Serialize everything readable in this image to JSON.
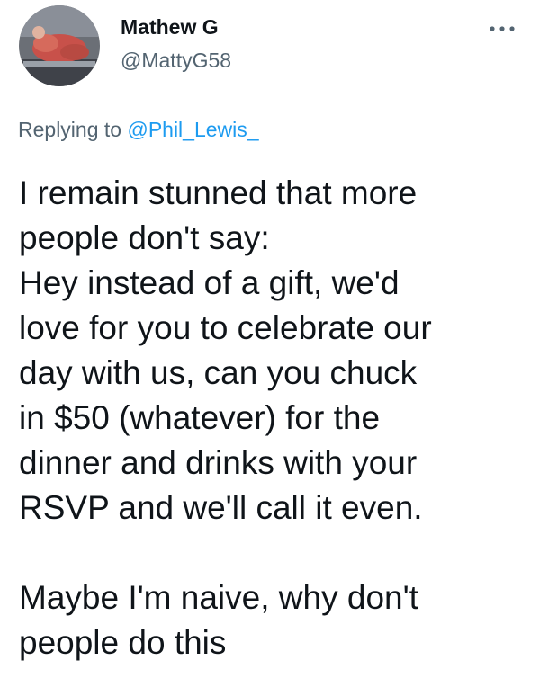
{
  "tweet": {
    "author": {
      "display_name": "Mathew G",
      "handle": "@MattyG58"
    },
    "reply": {
      "prefix": "Replying to ",
      "mention": "@Phil_Lewis_"
    },
    "text": {
      "lines": [
        "I remain stunned that more",
        "people don't say:",
        "Hey instead of a gift, we'd",
        "love for you to celebrate our",
        "day with us, can you chuck",
        "in $50 (whatever) for the",
        "dinner and drinks with your",
        "RSVP and we'll call it even."
      ],
      "lines2": [
        "Maybe I'm naive, why don't",
        "people do this"
      ]
    },
    "icons": {
      "more": "more-options-icon",
      "avatar": "avatar"
    },
    "colors": {
      "text": "#0f1419",
      "secondary": "#536471",
      "link": "#1d9bf0"
    }
  }
}
